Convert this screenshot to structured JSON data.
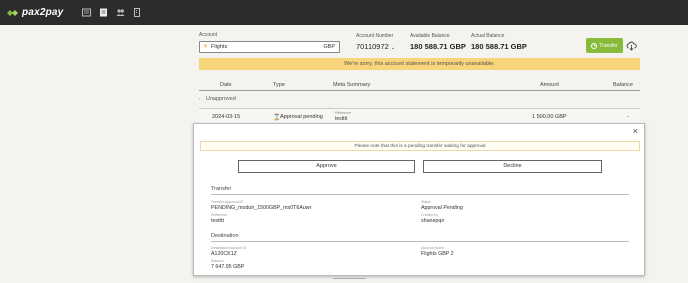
{
  "brand": {
    "name": "pax2pay",
    "accent": "#86bb3b"
  },
  "nav": {
    "icons": [
      "statement-icon",
      "document-icon",
      "users-icon",
      "organization-icon"
    ]
  },
  "account": {
    "label": "Account",
    "selected_name": "Flights",
    "selected_currency": "GBP",
    "number_label": "Account Number",
    "number_value": "70110972",
    "number_suffix": "⌄",
    "available_label": "Available Balance",
    "available_value": "180 588.71 GBP",
    "actual_label": "Actual Balance",
    "actual_value": "180 588.71 GBP"
  },
  "toolbar": {
    "transfer_label": "Transfer",
    "transfer_icon": "plus-circle-icon",
    "download_icon": "cloud-download-icon"
  },
  "warning": {
    "text": "We're sorry, this account statement is temporarily unavailable.",
    "color": "#f8d47a"
  },
  "table": {
    "headers": {
      "date": "Date",
      "type": "Type",
      "meta": "Meta Summary",
      "amount": "Amount",
      "balance": "Balance"
    },
    "group_label": "Unapproved",
    "row": {
      "date": "2024-03-15",
      "type": "Approval pending",
      "meta_label": "Reference",
      "meta_value": "testttt",
      "amount": "1 500.00 GBP",
      "balance": "-"
    }
  },
  "detail": {
    "note": "Please note that this is a pending transfer waiting for approval",
    "approve_label": "Approve",
    "decline_label": "Decline",
    "transfer": {
      "title": "Transfer",
      "id_label": "Transfer Approval ID",
      "id_value": "PENDING_modulr_1500GBP_ms0T6Auwr",
      "status_label": "Status",
      "status_value": "Approval Pending",
      "ref_label": "Reference",
      "ref_value": "testttt",
      "created_label": "Created by",
      "created_value": "shanepqe"
    },
    "destination": {
      "title": "Destination",
      "acc_label": "Destination Account ID",
      "acc_value": "A120CK1Z",
      "name_label": "Account Name",
      "name_value": "Flights GBP 2",
      "bal_label": "Balance",
      "bal_value": "7 647.95 GBP"
    }
  }
}
